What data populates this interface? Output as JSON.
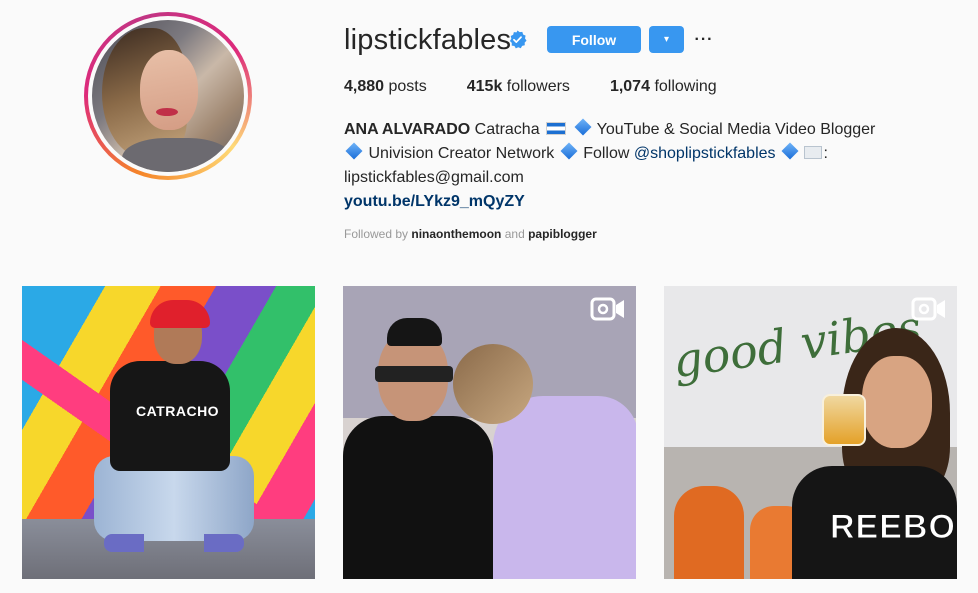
{
  "profile": {
    "username": "lipstickfables",
    "verified": true,
    "follow_label": "Follow",
    "dropdown_label": "▾",
    "more_label": "···"
  },
  "stats": {
    "posts_count": "4,880",
    "posts_label": "posts",
    "followers_count": "415k",
    "followers_label": "followers",
    "following_count": "1,074",
    "following_label": "following"
  },
  "bio": {
    "name": "ANA ALVARADO",
    "line1_text": "Catracha",
    "line1_tail": "YouTube & Social Media Video Blogger",
    "line2_a": "Univision Creator Network",
    "line2_b": "Follow",
    "line2_mention": "@shoplipstickfables",
    "line2_tail": ":",
    "email": "lipstickfables@gmail.com",
    "link": "youtu.be/LYkz9_mQyZY"
  },
  "followed_by": {
    "prefix": "Followed by",
    "user1": "ninaonthemoon",
    "joiner": "and",
    "user2": "papiblogger"
  },
  "posts": [
    {
      "type": "image",
      "shirt_text": "CATRACHO"
    },
    {
      "type": "video",
      "cap_text": ""
    },
    {
      "type": "video",
      "wall_text": "good vibes",
      "shirt_text": "REEBO"
    }
  ],
  "colors": {
    "follow_blue": "#3897f0",
    "link_blue": "#003569",
    "verified_blue": "#3897f0"
  }
}
